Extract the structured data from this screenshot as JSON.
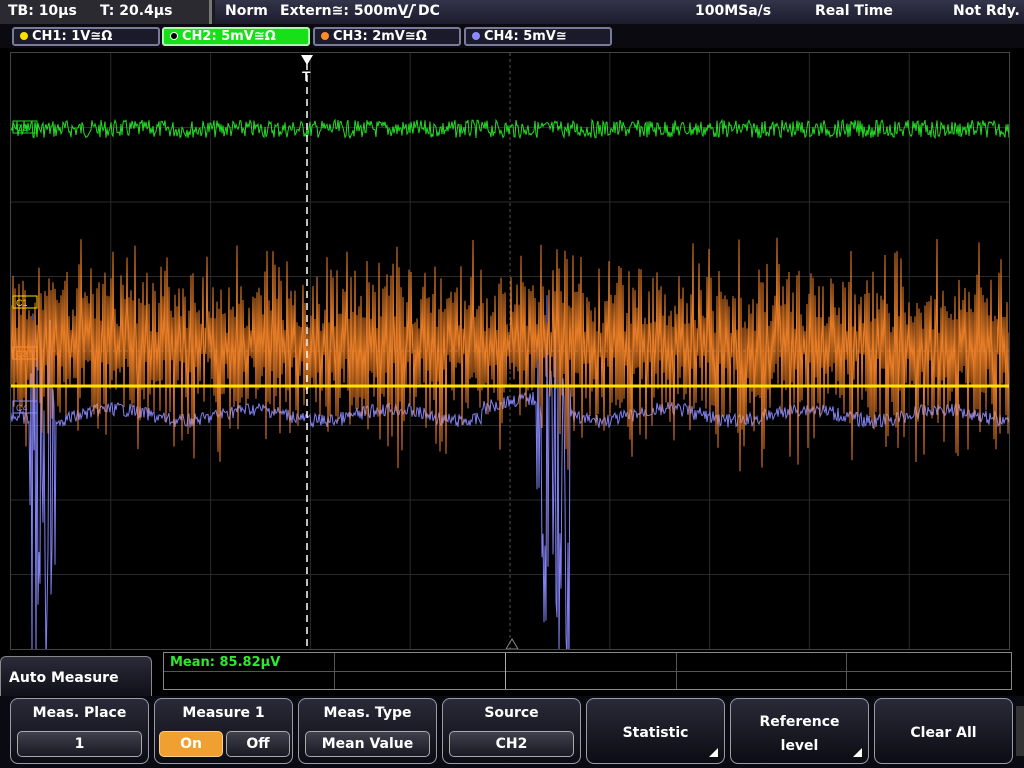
{
  "topbar": {
    "timebase": "TB: 10µs",
    "trigger_time": "T: 20.4µs",
    "mode": "Norm",
    "trigger_source": "Extern≅: 500mV",
    "trigger_coupling": "DC",
    "sample_rate": "100MSa/s",
    "acq_mode": "Real Time",
    "state": "Not Rdy."
  },
  "channels": [
    {
      "label": "CH1: 1V≅Ω",
      "color": "#ffe000",
      "marker": "C1"
    },
    {
      "label": "CH2: 5mV≅Ω",
      "color": "#22dd22",
      "marker": "C2",
      "active": true
    },
    {
      "label": "CH3: 2mV≅Ω",
      "color": "#ff8a2a",
      "marker": "C3"
    },
    {
      "label": "CH4: 5mV≅",
      "color": "#8a8aff",
      "marker": "C4"
    }
  ],
  "trigger_marker": "T",
  "measurement": {
    "result": "Mean: 85.82µV"
  },
  "menu": {
    "title": "Auto Measure",
    "meas_place": {
      "title": "Meas. Place",
      "value": "1"
    },
    "measure1": {
      "title": "Measure 1",
      "on": "On",
      "off": "Off",
      "selected": "On"
    },
    "meas_type": {
      "title": "Meas. Type",
      "value": "Mean Value"
    },
    "source": {
      "title": "Source",
      "value": "CH2"
    },
    "statistic": {
      "label": "Statistic"
    },
    "reference": {
      "line1": "Reference",
      "line2": "level"
    },
    "clear_all": {
      "label": "Clear All"
    }
  }
}
